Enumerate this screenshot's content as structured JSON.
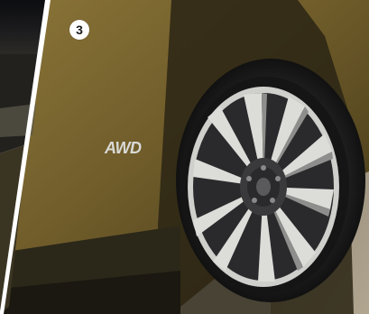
{
  "badge": {
    "number": "3"
  },
  "emblem": {
    "text": "AWD"
  },
  "colors": {
    "body_paint": "#7a6630",
    "tire": "#1b1b1b",
    "rim_silver": "#d8d8d6",
    "rim_dark": "#2a2a2c",
    "ground": "#9a8f7c",
    "divider": "#ffffff"
  }
}
